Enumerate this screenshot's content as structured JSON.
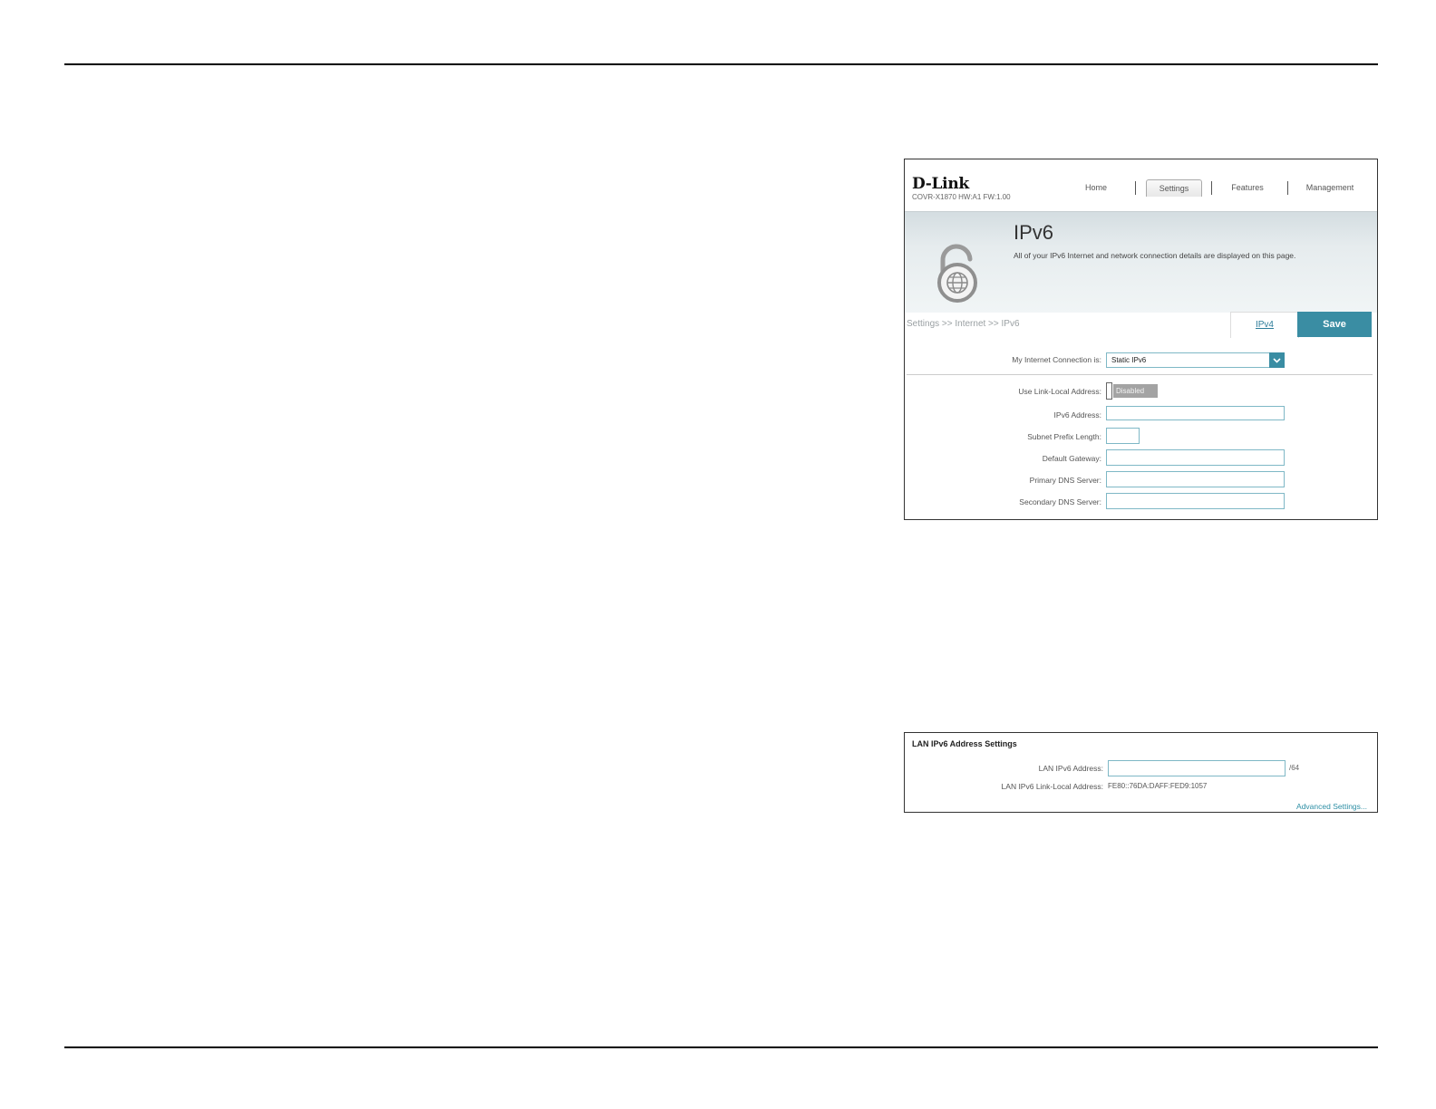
{
  "screen1": {
    "brand": "D-Link",
    "model": "COVR-X1870 HW:A1 FW:1.00",
    "nav": [
      "Home",
      "Settings",
      "Features",
      "Management"
    ],
    "active_nav": "Settings",
    "banner": {
      "title": "IPv6",
      "description": "All of your IPv6 Internet and network connection details are displayed on this page."
    },
    "breadcrumb": "Settings >> Internet >> IPv6",
    "tab_ipv4": "IPv4",
    "save_label": "Save",
    "connection_label": "My Internet Connection is:",
    "connection_value": "Static IPv6",
    "link_local_label": "Use Link-Local Address:",
    "link_local_state": "Disabled",
    "fields": {
      "ipv6_address": {
        "label": "IPv6 Address:",
        "value": ""
      },
      "subnet_prefix": {
        "label": "Subnet Prefix Length:",
        "value": ""
      },
      "default_gateway": {
        "label": "Default Gateway:",
        "value": ""
      },
      "primary_dns": {
        "label": "Primary DNS Server:",
        "value": ""
      },
      "secondary_dns": {
        "label": "Secondary DNS Server:",
        "value": ""
      }
    },
    "colors": {
      "accent": "#3a8da3",
      "field_border": "#7fb8c6",
      "toggle_off": "#a3a3a3"
    }
  },
  "screen2": {
    "title": "LAN IPv6 Address Settings",
    "lan_address_label": "LAN IPv6 Address:",
    "lan_address_value": "",
    "lan_address_suffix": "/64",
    "link_local_label": "LAN IPv6 Link-Local Address:",
    "link_local_value": "FE80::76DA:DAFF:FED9:1057",
    "advanced_link": "Advanced Settings..."
  }
}
